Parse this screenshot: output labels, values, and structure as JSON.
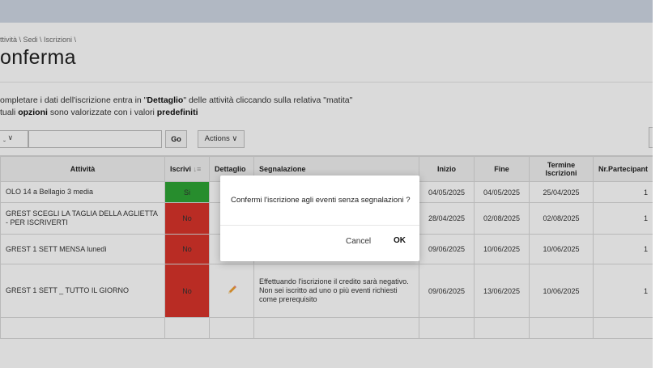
{
  "breadcrumb": {
    "text": "ttività \\ Sedi \\ Iscrizioni \\"
  },
  "page": {
    "title": "onferma"
  },
  "instructions": {
    "line1_prefix": "ompletare i dati dell'iscrizione entra in \"",
    "line1_bold": "Dettaglio",
    "line1_suffix": "\" delle attività cliccando sulla relativa \"matita\"",
    "line2_prefix": "tuali ",
    "line2_bold1": "opzioni",
    "line2_middle": " sono valorizzate con i valori ",
    "line2_bold2": "predefiniti"
  },
  "toolbar": {
    "select_value": "ˬ ∨",
    "search_value": "",
    "go_label": "Go",
    "actions_label": "Actions ∨"
  },
  "table": {
    "headers": {
      "attivita": "Attività",
      "iscrivi": "Iscrivi",
      "iscrivi_sort_icon": "↓≡",
      "dettaglio": "Dettaglio",
      "segnalazione": "Segnalazione",
      "inizio": "Inizio",
      "fine": "Fine",
      "termine": "Termine Iscrizioni",
      "partecipanti": "Nr.Partecipant"
    },
    "rows": [
      {
        "attivita": "OLO 14 a Bellagio 3 media",
        "iscrivi": "Si",
        "iscrivi_status": "si",
        "dettaglio_icon": "",
        "segnalazione": "",
        "inizio": "04/05/2025",
        "fine": "04/05/2025",
        "termine": "25/04/2025",
        "partecipanti": "1"
      },
      {
        "attivita": "GREST SCEGLI LA TAGLIA DELLA AGLIETTA - PER ISCRIVERTI",
        "iscrivi": "No",
        "iscrivi_status": "no",
        "dettaglio_icon": "",
        "segnalazione": "",
        "inizio": "28/04/2025",
        "fine": "02/08/2025",
        "termine": "02/08/2025",
        "partecipanti": "1"
      },
      {
        "attivita": "GREST 1 SETT MENSA lunedì",
        "iscrivi": "No",
        "iscrivi_status": "no",
        "dettaglio_icon": "",
        "segnalazione": "",
        "inizio": "09/06/2025",
        "fine": "10/06/2025",
        "termine": "10/06/2025",
        "partecipanti": "1"
      },
      {
        "attivita": "GREST 1 SETT _ TUTTO IL GIORNO",
        "iscrivi": "No",
        "iscrivi_status": "no",
        "dettaglio_icon": "pencil-icon",
        "segnalazione_line1": "Effettuando l'iscrizione il credito sarà negativo.",
        "segnalazione_line2": "Non sei iscritto ad uno o più eventi richiesti come prerequisito",
        "inizio": "09/06/2025",
        "fine": "13/06/2025",
        "termine": "10/06/2025",
        "partecipanti": "1"
      }
    ]
  },
  "dialog": {
    "message": "Confermi l'iscrizione agli eventi senza segnalazioni ?",
    "cancel_label": "Cancel",
    "ok_label": "OK"
  },
  "colors": {
    "accent_green": "#2ea535",
    "accent_red": "#d9342b",
    "header_bar": "#cfd8e4",
    "overlay": "rgba(0,0,0,0.145)"
  }
}
